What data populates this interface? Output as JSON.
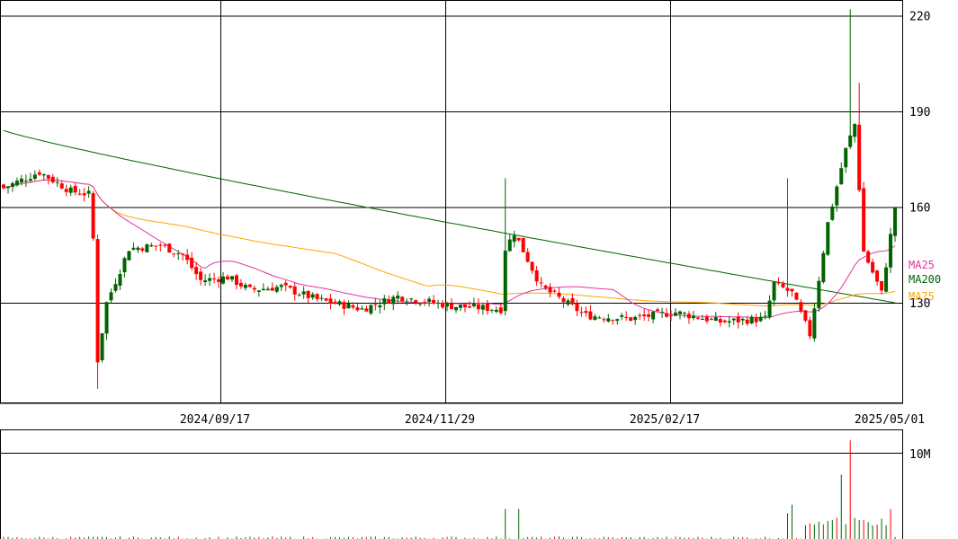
{
  "chart_data": [
    {
      "type": "candlestick",
      "panel": "price",
      "ylim": [
        100,
        225
      ],
      "yticks": [
        130,
        160,
        190,
        220
      ],
      "x_date_labels": [
        "2024/09/17",
        "2024/11/29",
        "2025/02/17",
        "2025/05/01"
      ],
      "grid": true,
      "up_color": "#006400",
      "down_color": "#ff0000",
      "legend_placement": "right",
      "legend": [
        {
          "name": "MA25",
          "color": "#e0359f"
        },
        {
          "name": "MA200",
          "color": "#006400"
        },
        {
          "name": "MA75",
          "color": "#ffa500"
        }
      ],
      "key_points": [
        {
          "date": "2024/07",
          "ohlc": [
            168,
            168,
            163,
            166
          ]
        },
        {
          "date": "2024/08",
          "ohlc": [
            163,
            163,
            105,
            112
          ]
        },
        {
          "date": "2024/09/17",
          "ohlc": [
            148,
            152,
            143,
            150
          ]
        },
        {
          "date": "2024/11/29",
          "ohlc": [
            131,
            132,
            127,
            129
          ]
        },
        {
          "date": "2024/12",
          "ohlc": [
            155,
            163,
            135,
            142
          ]
        },
        {
          "date": "2025/02/17",
          "ohlc": [
            128,
            130,
            124,
            127
          ]
        },
        {
          "date": "2025/04",
          "ohlc": [
            170,
            222,
            160,
            185
          ]
        },
        {
          "date": "2025/05/01",
          "ohlc": [
            135,
            165,
            133,
            163
          ]
        }
      ],
      "ma200_approx": [
        184,
        130
      ],
      "ma75_approx": [
        166,
        131
      ],
      "ma25_approx": [
        166,
        139
      ]
    },
    {
      "type": "bar",
      "panel": "volume",
      "yticks_label": [
        "10M"
      ],
      "ytick_values": [
        10000000
      ],
      "peak_volume": 11500000
    }
  ]
}
